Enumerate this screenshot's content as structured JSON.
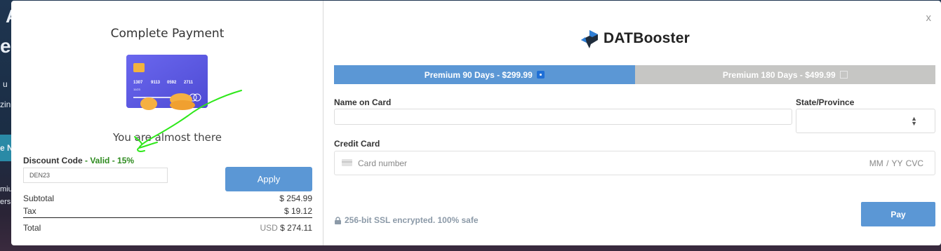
{
  "background": {
    "fragments": [
      "A",
      "e",
      "u",
      "zin",
      "e N",
      "miu",
      "ersh"
    ]
  },
  "payment": {
    "title": "Complete Payment",
    "card": {
      "number_groups": [
        "1307",
        "9113",
        "0592",
        "2711"
      ],
      "name_text": "11/23"
    },
    "almost_text": "You are almost there",
    "discount": {
      "label": "Discount Code",
      "separator": " - ",
      "status": "Valid - 15%",
      "value": "DEN23",
      "apply_label": "Apply"
    },
    "summary": {
      "subtotal_label": "Subtotal",
      "subtotal_value": "$ 254.99",
      "tax_label": "Tax",
      "tax_value": "$ 19.12",
      "total_label": "Total",
      "currency": "USD",
      "total_value": "$ 274.11"
    }
  },
  "checkout": {
    "close_label": "x",
    "brand": "DATBooster",
    "plans": [
      {
        "label": "Premium 90 Days - $299.99",
        "selected": true
      },
      {
        "label": "Premium 180 Days - $499.99",
        "selected": false
      }
    ],
    "name_label": "Name on Card",
    "name_value": "",
    "state_label": "State/Province",
    "state_value": "",
    "cc_label": "Credit Card",
    "cc_placeholder": "Card number",
    "cc_exp_placeholder": "MM / YY  CVC",
    "ssl_text": "256-bit SSL encrypted. 100% safe",
    "pay_label": "Pay"
  },
  "colors": {
    "accent": "#5b97d5",
    "valid_green": "#2e8b1f",
    "inactive_plan": "#c6c6c4",
    "annotation_green": "#2ee81a"
  }
}
